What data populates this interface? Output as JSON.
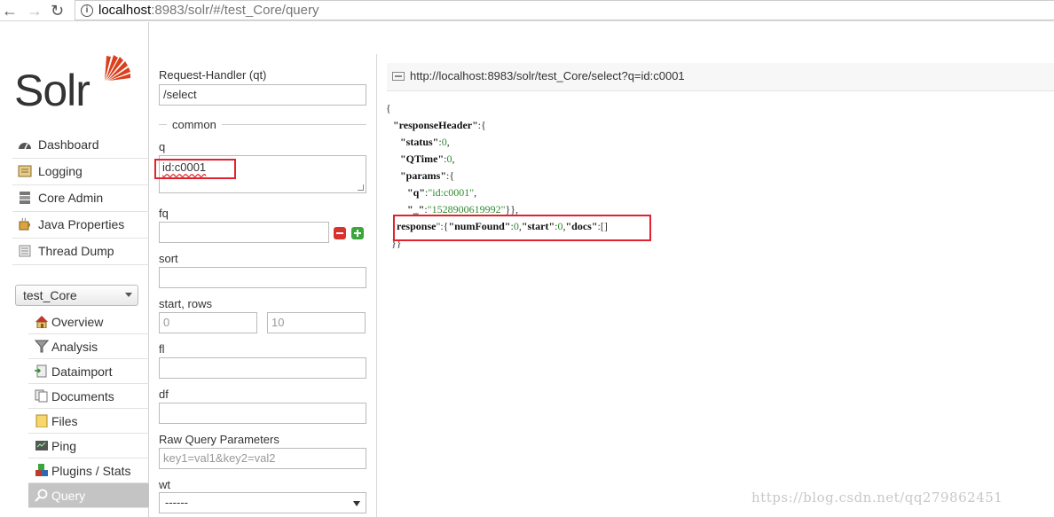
{
  "browser": {
    "url_host": "localhost",
    "url_rest": ":8983/solr/#/test_Core/query"
  },
  "app": {
    "logo_text": "Solr"
  },
  "sidebar": {
    "items": [
      {
        "label": "Dashboard",
        "icon": "dashboard-icon"
      },
      {
        "label": "Logging",
        "icon": "logging-icon"
      },
      {
        "label": "Core Admin",
        "icon": "core-admin-icon"
      },
      {
        "label": "Java Properties",
        "icon": "java-properties-icon"
      },
      {
        "label": "Thread Dump",
        "icon": "thread-dump-icon"
      }
    ],
    "core_selector": "test_Core",
    "core_items": [
      {
        "label": "Overview",
        "icon": "overview-icon"
      },
      {
        "label": "Analysis",
        "icon": "analysis-icon"
      },
      {
        "label": "Dataimport",
        "icon": "dataimport-icon"
      },
      {
        "label": "Documents",
        "icon": "documents-icon"
      },
      {
        "label": "Files",
        "icon": "files-icon"
      },
      {
        "label": "Ping",
        "icon": "ping-icon"
      },
      {
        "label": "Plugins / Stats",
        "icon": "plugins-icon"
      },
      {
        "label": "Query",
        "icon": "query-icon",
        "active": true
      }
    ]
  },
  "form": {
    "handler_label": "Request-Handler (qt)",
    "handler_value": "/select",
    "common_legend": "common",
    "q_label": "q",
    "q_value": "id:c0001",
    "fq_label": "fq",
    "sort_label": "sort",
    "start_rows_label": "start, rows",
    "start_placeholder": "0",
    "rows_placeholder": "10",
    "fl_label": "fl",
    "df_label": "df",
    "raw_label": "Raw Query Parameters",
    "raw_placeholder": "key1=val1&key2=val2",
    "wt_label": "wt",
    "wt_value": "------"
  },
  "results": {
    "request_url": "http://localhost:8983/solr/test_Core/select?q=id:c0001",
    "json": {
      "open_brace": "{",
      "responseHeader_key": "\"responseHeader\"",
      "status_key": "\"status\"",
      "status_val": "0",
      "qtime_key": "\"QTime\"",
      "qtime_val": "0",
      "params_key": "\"params\"",
      "q_key": "\"q\"",
      "q_val": "\"id:c0001\"",
      "underscore_key": "\"_\"",
      "underscore_val": "\"1528900619992\"",
      "response_key": "response",
      "numFound_key": "\"numFound\"",
      "numFound_val": "0",
      "start_key": "\"start\"",
      "start_val": "0",
      "docs_key": "\"docs\"",
      "docs_val": "[]",
      "close_brace": "}}"
    }
  },
  "watermark": "https://blog.csdn.net/qq279862451",
  "colors": {
    "highlight_box": "#e0232e",
    "logo_accent": "#d9411e",
    "json_value": "#2d8a2d"
  }
}
